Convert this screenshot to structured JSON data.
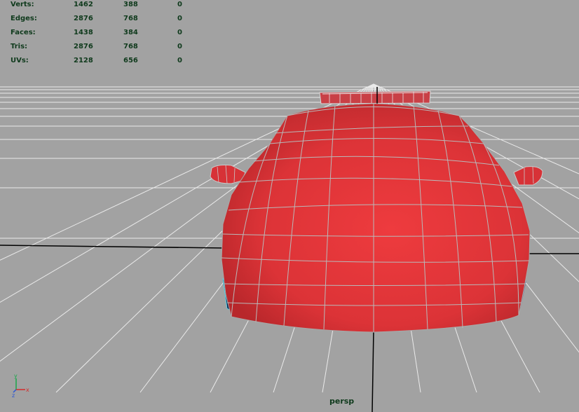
{
  "hud": {
    "rows": [
      {
        "label": "Verts:",
        "total": "1462",
        "selected": "388",
        "extra": "0"
      },
      {
        "label": "Edges:",
        "total": "2876",
        "selected": "768",
        "extra": "0"
      },
      {
        "label": "Faces:",
        "total": "1438",
        "selected": "384",
        "extra": "0"
      },
      {
        "label": "Tris:",
        "total": "2876",
        "selected": "768",
        "extra": "0"
      },
      {
        "label": "UVs:",
        "total": "2128",
        "selected": "656",
        "extra": "0"
      }
    ]
  },
  "viewport": {
    "camera": "persp",
    "background_color": "#a2a2a2",
    "grid_color": "#ffffff",
    "axis_line_color": "#000000",
    "mesh_color": "#d9353a",
    "wire_color": "#b0b0b0"
  },
  "gizmo": {
    "y_label": "y",
    "x_label": "x",
    "z_label": "z"
  }
}
